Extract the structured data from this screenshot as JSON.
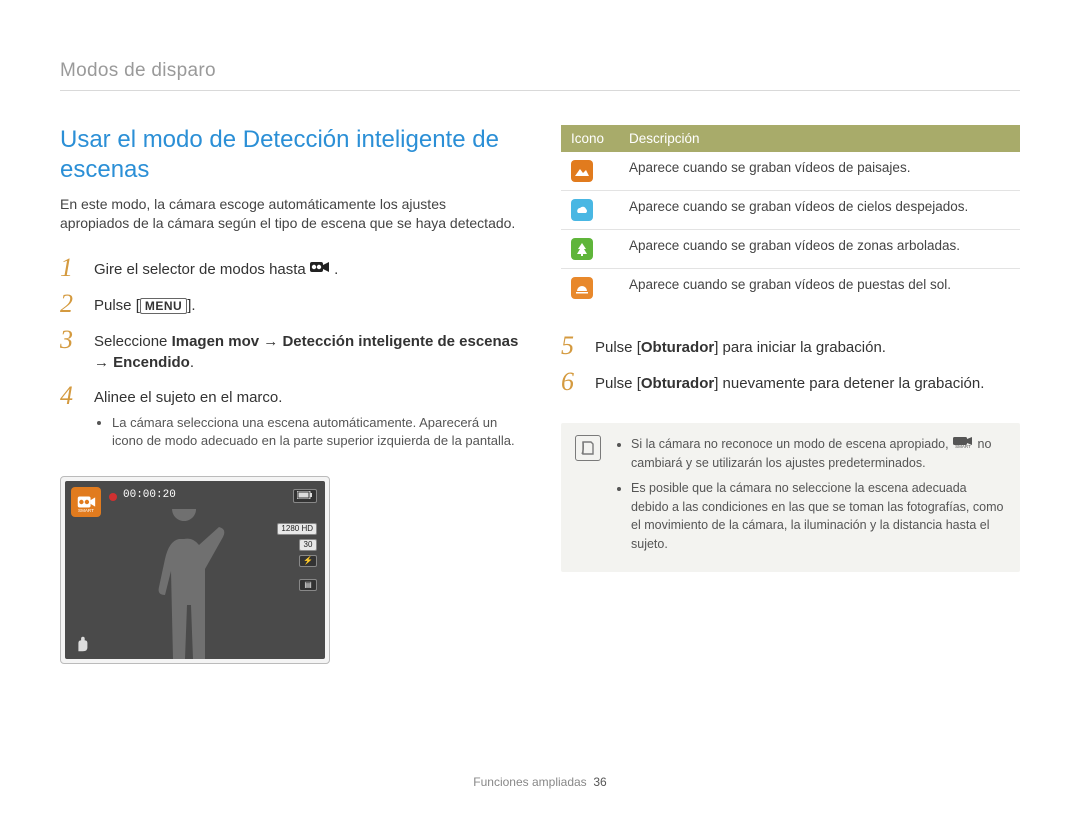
{
  "header": {
    "section": "Modos de disparo"
  },
  "title": "Usar el modo de Detección inteligente de escenas",
  "intro": "En este modo, la cámara escoge automáticamente los ajustes apropiados de la cámara según el tipo de escena que se haya detectado.",
  "steps_left": {
    "s1_pre": "Gire el selector de modos hasta ",
    "s1_post": ".",
    "s2_pre": "Pulse [",
    "s2_menu": "MENU",
    "s2_post": "].",
    "s3_a": "Seleccione ",
    "s3_b": "Imagen mov",
    "s3_arrow1": " → ",
    "s3_c": "Detección inteligente de escenas",
    "s3_arrow2": " → ",
    "s3_d": "Encendido",
    "s3_e": ".",
    "s4": "Alinee el sujeto en el marco.",
    "s4_sub": "La cámara selecciona una escena automáticamente. Aparecerá un icono de modo adecuado en la parte superior izquierda de la pantalla."
  },
  "lcd": {
    "timer": "00:00:20",
    "ind1": "1280 HD",
    "ind2": "30",
    "ind3": "⚡",
    "ind_card": "▤"
  },
  "nums": {
    "n1": "1",
    "n2": "2",
    "n3": "3",
    "n4": "4",
    "n5": "5",
    "n6": "6"
  },
  "table": {
    "h1": "Icono",
    "h2": "Descripción",
    "rows": [
      {
        "icon": "landscape",
        "desc": "Aparece cuando se graban vídeos de paisajes."
      },
      {
        "icon": "sky",
        "desc": "Aparece cuando se graban vídeos de cielos despejados."
      },
      {
        "icon": "forest",
        "desc": "Aparece cuando se graban vídeos de zonas arboladas."
      },
      {
        "icon": "sunset",
        "desc": "Aparece cuando se graban vídeos de puestas del sol."
      }
    ]
  },
  "steps_right": {
    "s5_a": "Pulse [",
    "s5_b": "Obturador",
    "s5_c": "] para iniciar la grabación.",
    "s6_a": "Pulse [",
    "s6_b": "Obturador",
    "s6_c": "] nuevamente para detener la grabación."
  },
  "note": {
    "items": [
      {
        "pre": "Si la cámara no reconoce un modo de escena apropiado, ",
        "post": " no cambiará y se utilizarán los ajustes predeterminados."
      },
      {
        "text": "Es posible que la cámara no seleccione la escena adecuada debido a las condiciones en las que se toman las fotografías, como el movimiento de la cámara, la iluminación y la distancia hasta el sujeto."
      }
    ]
  },
  "footer": {
    "label": "Funciones ampliadas",
    "page": "36"
  }
}
